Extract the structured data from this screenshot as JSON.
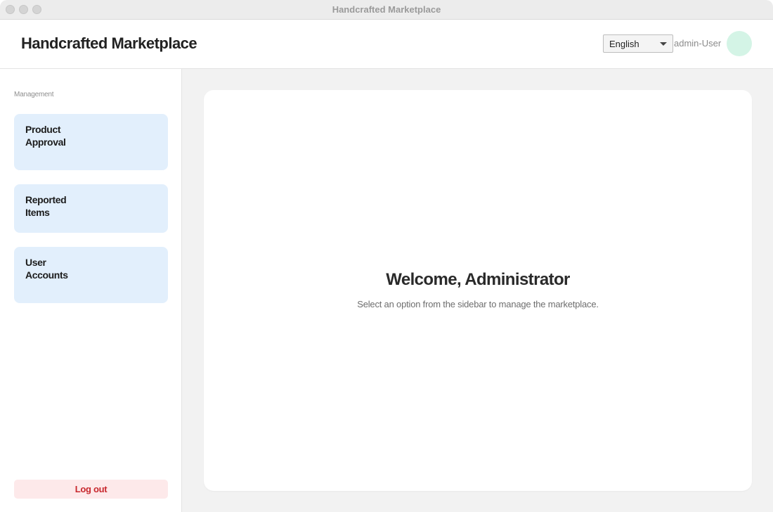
{
  "window": {
    "title": "Handcrafted Marketplace"
  },
  "header": {
    "app_title": "Handcrafted Marketplace",
    "language": {
      "selected": "English"
    },
    "user": {
      "name": "admin-User"
    }
  },
  "sidebar": {
    "section_label": "Management",
    "items": [
      {
        "label": "Product Approval"
      },
      {
        "label": "Reported Items"
      },
      {
        "label": "User Accounts"
      }
    ],
    "logout_label": "Log out"
  },
  "main": {
    "welcome_title": "Welcome, Administrator",
    "welcome_subtitle": "Select an option from the sidebar to manage the marketplace."
  },
  "colors": {
    "nav_item_bg": "#e2effc",
    "logout_bg": "#fde9ea",
    "logout_text": "#c8282e",
    "avatar_bg": "#d4f4e6",
    "main_bg": "#f2f2f2"
  }
}
